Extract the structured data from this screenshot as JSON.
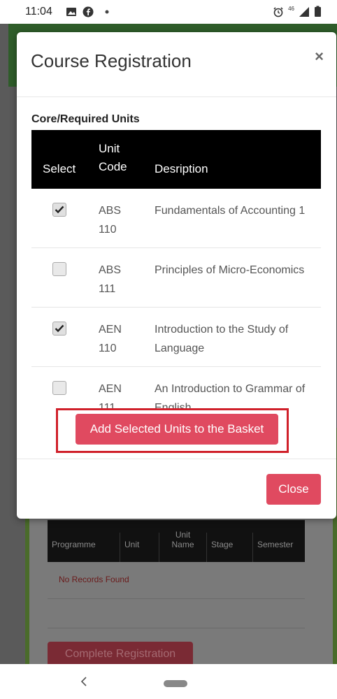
{
  "statusbar": {
    "time": "11:04",
    "signal": "46"
  },
  "background": {
    "table_headers": [
      "Programme",
      "Unit",
      "Unit Name",
      "Stage",
      "Semester"
    ],
    "no_records": "No Records Found",
    "complete_button": "Complete Registration"
  },
  "modal": {
    "title": "Course Registration",
    "close_x": "×",
    "section_title": "Core/Required Units",
    "columns": {
      "select": "Select",
      "code": "Unit Code",
      "description": "Desription"
    },
    "rows": [
      {
        "checked": true,
        "code": "ABS 110",
        "description": "Fundamentals of Accounting 1"
      },
      {
        "checked": false,
        "code": "ABS 111",
        "description": "Principles of Micro-Economics"
      },
      {
        "checked": true,
        "code": "AEN 110",
        "description": "Introduction to the Study of Language"
      },
      {
        "checked": false,
        "code": "AEN 111",
        "description": "An Introduction to Grammar of English"
      }
    ],
    "add_button": "Add Selected Units to the Basket",
    "close_button": "Close"
  },
  "colors": {
    "accent": "#e04a60",
    "highlight_box": "#d0202a",
    "table_header": "#000000"
  },
  "icons": {
    "nav_back": "chevron-left-icon",
    "nav_home": "home-pill-icon"
  }
}
